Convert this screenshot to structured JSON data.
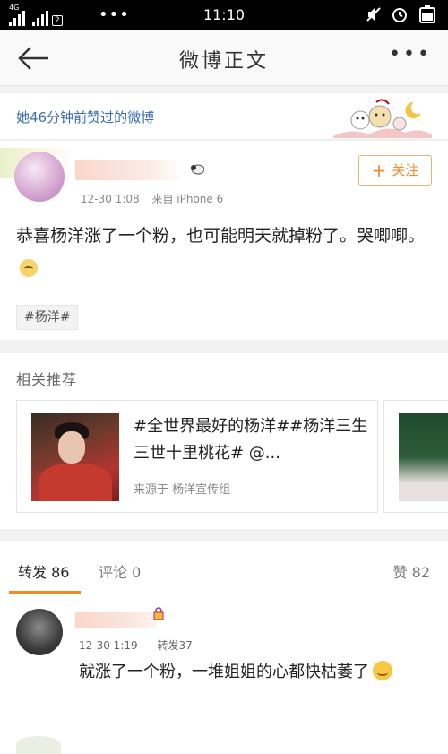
{
  "status_bar": {
    "signal_label": "4G",
    "sim_number": "2",
    "more_dots": "•••",
    "time": "11:10"
  },
  "nav": {
    "title": "微博正文",
    "more": "•••"
  },
  "liked_banner": {
    "text": "她46分钟前赞过的微博"
  },
  "post": {
    "meta_time": "12-30 1:08",
    "meta_source": "来自 iPhone 6",
    "follow_label": "关注",
    "body_line": "恭喜杨洋涨了一个粉，也可能明天就掉粉了。哭唧唧。",
    "topic_tag": "#杨洋#"
  },
  "related": {
    "title": "相关推荐",
    "card_text": "#全世界最好的杨洋##杨洋三生三世十里桃花# @...",
    "card_source": "来源于 杨洋宣传组"
  },
  "tabs": {
    "forward": "转发 86",
    "comment": "评论 0",
    "like": "赞 82"
  },
  "forward_item": {
    "time": "12-30 1:19",
    "count": "转发37",
    "text": "就涨了一个粉，一堆姐姐的心都快枯萎了"
  },
  "colors": {
    "accent": "#f08a2a",
    "link_blue": "#3b6db3"
  }
}
